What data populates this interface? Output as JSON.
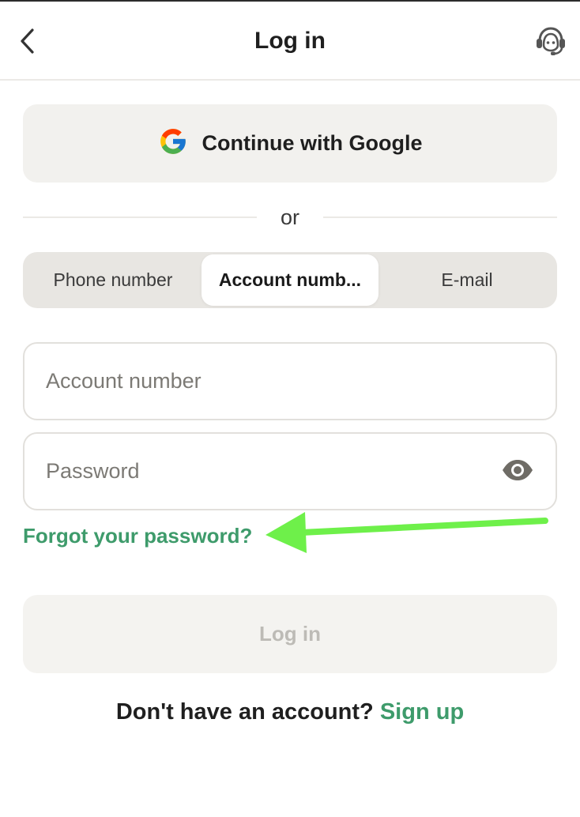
{
  "header": {
    "title": "Log in",
    "back_icon": "chevron-left-icon",
    "support_icon": "headset-support-icon"
  },
  "google": {
    "label": "Continue with Google",
    "icon": "google-logo-icon"
  },
  "divider": {
    "text": "or"
  },
  "tabs": [
    {
      "label": "Phone number",
      "active": false
    },
    {
      "label": "Account numb...",
      "active": true
    },
    {
      "label": "E-mail",
      "active": false
    }
  ],
  "fields": {
    "account": {
      "placeholder": "Account number",
      "value": ""
    },
    "password": {
      "placeholder": "Password",
      "value": "",
      "eye_icon": "eye-icon"
    }
  },
  "forgot_link": "Forgot your password?",
  "login_button": "Log in",
  "signup": {
    "prompt": "Don't have an account?",
    "link": "Sign up"
  },
  "colors": {
    "accent_green": "#3e9b6b",
    "annotation_arrow": "#6ef04a",
    "button_bg": "#f2f1ee",
    "tabs_bg": "#e8e6e2",
    "disabled_text": "#bdbbb6"
  }
}
